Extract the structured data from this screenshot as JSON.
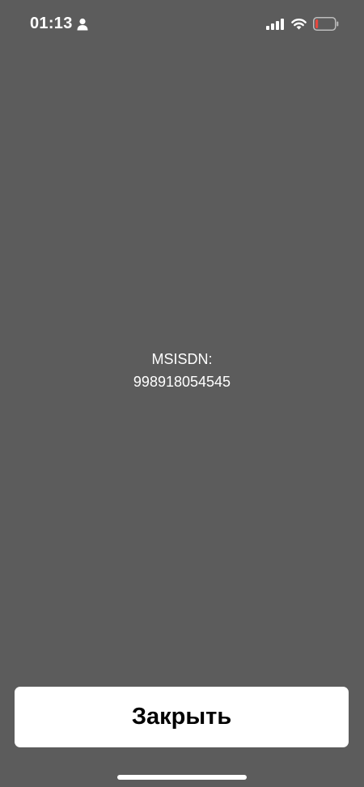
{
  "status_bar": {
    "time": "01:13",
    "icons": [
      "person-icon",
      "cellular-signal-icon",
      "wifi-icon",
      "battery-low-icon"
    ],
    "battery_color": "#e5483f"
  },
  "main": {
    "label": "MSISDN:",
    "value": "998918054545"
  },
  "close_button": {
    "label": "Закрыть"
  },
  "colors": {
    "background": "#5c5c5c",
    "button_background": "#ffffff",
    "button_text": "#000000",
    "text": "#ffffff"
  }
}
